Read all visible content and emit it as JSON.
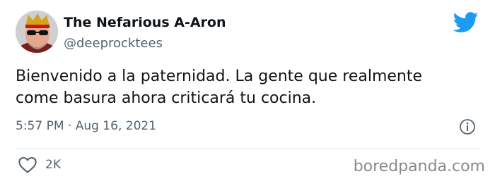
{
  "tweet": {
    "display_name": "The Nefarious A-Aron",
    "handle": "@deeprocktees",
    "text": "Bienvenido a la paternidad. La gente que realmente come basura ahora criticará tu cocina.",
    "time": "5:57 PM · Aug 16, 2021",
    "likes": "2K"
  },
  "icons": {
    "brand": "twitter-bird-icon",
    "info": "info-icon",
    "like": "heart-icon"
  },
  "watermark": "boredpanda.com",
  "colors": {
    "twitter_blue": "#1d9bf0",
    "text": "#0f1419",
    "muted": "#536471"
  }
}
